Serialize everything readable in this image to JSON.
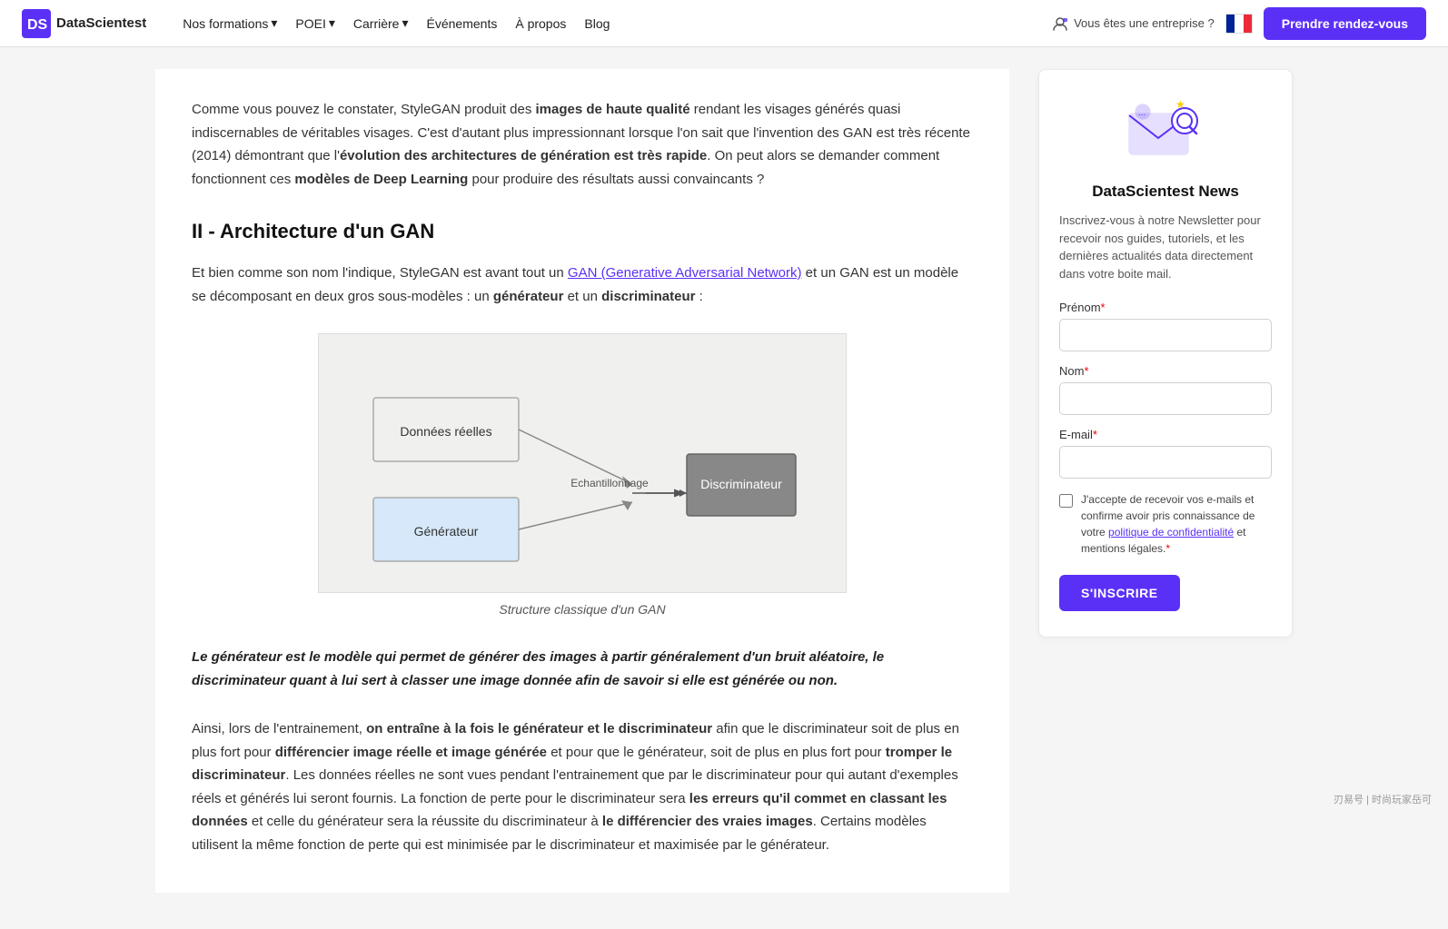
{
  "navbar": {
    "logo_text": "DataScientest",
    "nav_items": [
      {
        "label": "Nos formations",
        "has_dropdown": true
      },
      {
        "label": "POEI",
        "has_dropdown": true
      },
      {
        "label": "Carrière",
        "has_dropdown": true
      },
      {
        "label": "Événements",
        "has_dropdown": false
      },
      {
        "label": "À propos",
        "has_dropdown": false
      },
      {
        "label": "Blog",
        "has_dropdown": false
      }
    ],
    "enterprise_label": "Vous êtes une entreprise ?",
    "rdv_label": "Prendre rendez-vous"
  },
  "main": {
    "intro_paragraph": "Comme vous pouvez le constater, StyleGAN produit des",
    "intro_bold1": "images de haute qualité",
    "intro_mid1": "rendant les visages générés quasi indiscernables de véritables visages. C'est d'autant plus impressionnant lorsque l'on sait que l'invention des GAN est très récente (2014) démontrant que l'",
    "intro_bold2": "évolution des architectures de génération est très rapide",
    "intro_mid2": ". On peut alors se demander comment fonctionnent ces",
    "intro_bold3": "modèles de Deep Learning",
    "intro_end": "pour produire des résultats aussi convaincants ?",
    "section_title": "II - Architecture d'un GAN",
    "para1_start": "Et bien comme son nom l'indique, StyleGAN est avant tout un",
    "para1_link": "GAN (Generative Adversarial Network)",
    "para1_mid": "et un GAN est un modèle se décomposant en deux gros sous-modèles : un",
    "para1_bold1": "générateur",
    "para1_and": "et un",
    "para1_bold2": "discriminateur",
    "para1_end": ":",
    "diagram_caption": "Structure classique d'un GAN",
    "diagram": {
      "box1_label": "Données réelles",
      "box2_label": "Générateur",
      "arrow_label": "Echantillonnage",
      "box3_label": "Discriminateur"
    },
    "blockquote": "Le générateur est le modèle qui permet de générer des images à partir généralement d'un bruit aléatoire, le discriminateur quant à lui sert à classer une image donnée afin de savoir si elle est générée ou non.",
    "bottom_para1_start": "Ainsi, lors de l'entrainement,",
    "bottom_bold1": "on entraîne à la fois le générateur et le discriminateur",
    "bottom_mid1": "afin que le discriminateur soit de plus en plus fort pour",
    "bottom_bold2": "différencier image réelle et image générée",
    "bottom_mid2": "et pour que le générateur, soit de plus en plus fort pour",
    "bottom_bold3": "tromper le discriminateur",
    "bottom_mid3": ". Les données réelles ne sont vues pendant l'entrainement que par le discriminateur pour qui autant d'exemples réels et générés lui seront fournis. La fonction de perte pour le discriminateur sera",
    "bottom_bold4": "les erreurs qu'il commet en classant les données",
    "bottom_mid4": "et celle du générateur sera la réussite du discriminateur à",
    "bottom_bold5": "le différencier des vraies images",
    "bottom_end": ". Certains modèles utilisent la même fonction de perte qui est minimisée par le discriminateur et maximisée par le générateur."
  },
  "sidebar": {
    "title": "DataScientest News",
    "description": "Inscrivez-vous à notre Newsletter pour recevoir nos guides, tutoriels, et les dernières actualités data directement dans votre boite mail.",
    "prenom_label": "Prénom",
    "nom_label": "Nom",
    "email_label": "E-mail",
    "consent_text": "J'accepte de recevoir vos e-mails et confirme avoir pris connaissance de votre politique de confidentialité et mentions légales.",
    "subscribe_btn": "S'INSCRIRE",
    "required_marker": "*"
  },
  "watermark": "刃易号 | 时尚玩家岳可"
}
